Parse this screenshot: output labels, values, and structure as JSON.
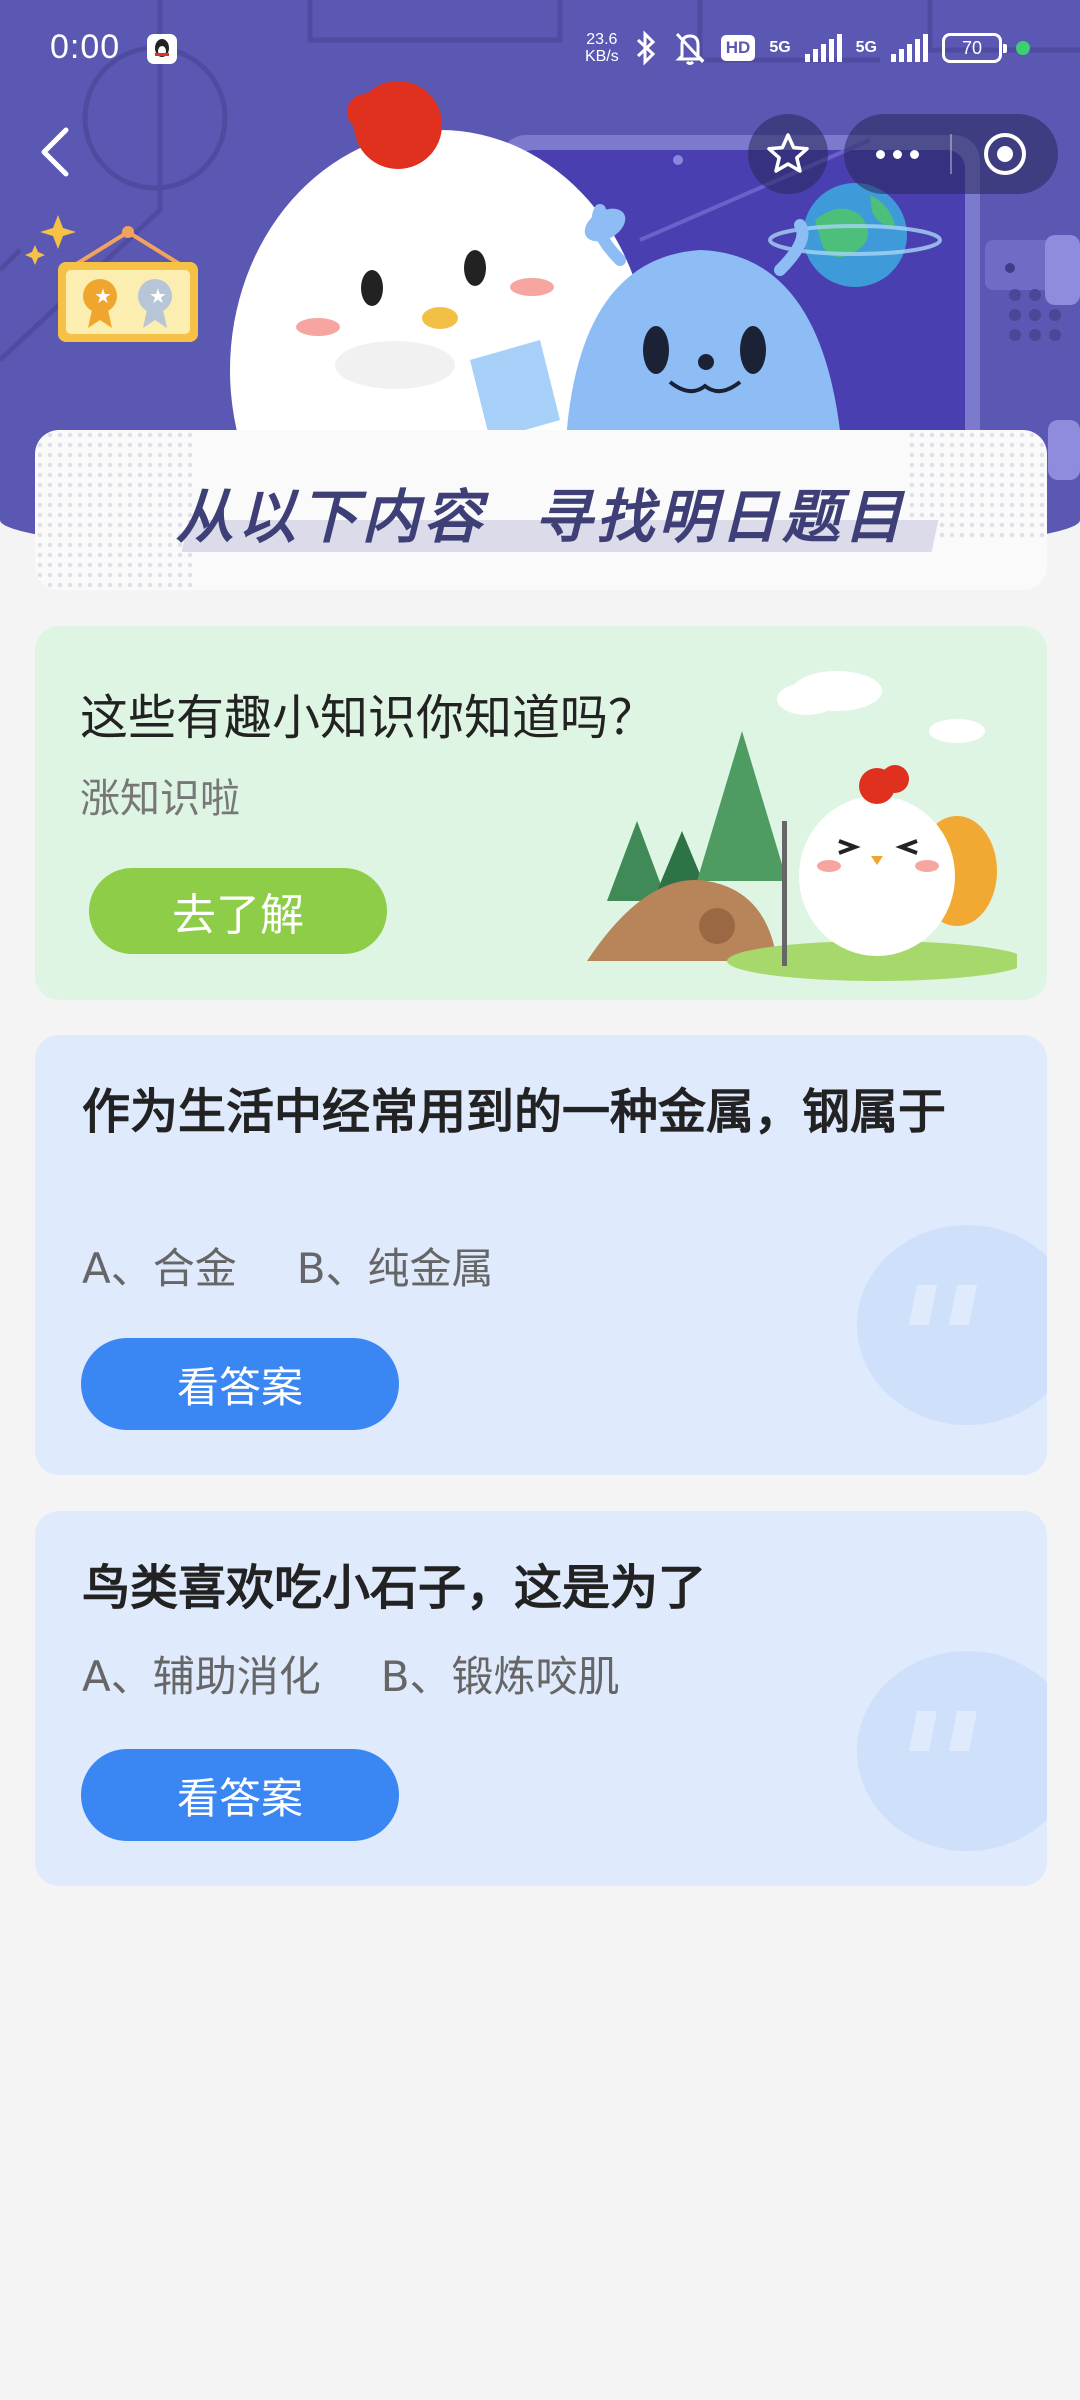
{
  "status_bar": {
    "time": "0:00",
    "speed_value": "23.6",
    "speed_unit": "KB/s",
    "network_1": "5G",
    "network_2": "5G",
    "battery": "70",
    "icons": [
      "qq-icon",
      "bluetooth-icon",
      "bell-muted-icon",
      "hd-icon",
      "signal-icon",
      "battery-icon"
    ]
  },
  "nav": {
    "back_icon": "chevron-left-icon",
    "favorite_icon": "star-icon",
    "more_icon": "more-dots-icon",
    "close_icon": "target-circle-icon"
  },
  "banner": {
    "title": "从以下内容  寻找明日题目"
  },
  "knowledge_card": {
    "title": "这些有趣小知识你知道吗？",
    "subtitle": "涨知识啦",
    "button_label": "去了解",
    "color": "#def5e4",
    "button_color": "#8dcd48"
  },
  "questions": [
    {
      "title": "作为生活中经常用到的一种金属，钢属于",
      "option_a": "A、合金",
      "option_b": "B、纯金属",
      "button_label": "看答案"
    },
    {
      "title": "鸟类喜欢吃小石子，这是为了",
      "option_a": "A、辅助消化",
      "option_b": "B、锻炼咬肌",
      "button_label": "看答案"
    }
  ],
  "colors": {
    "header": "#5b58b3",
    "question_card": "#dfeafd",
    "answer_button": "#3a86f2",
    "page_bg": "#f4f4f4"
  }
}
